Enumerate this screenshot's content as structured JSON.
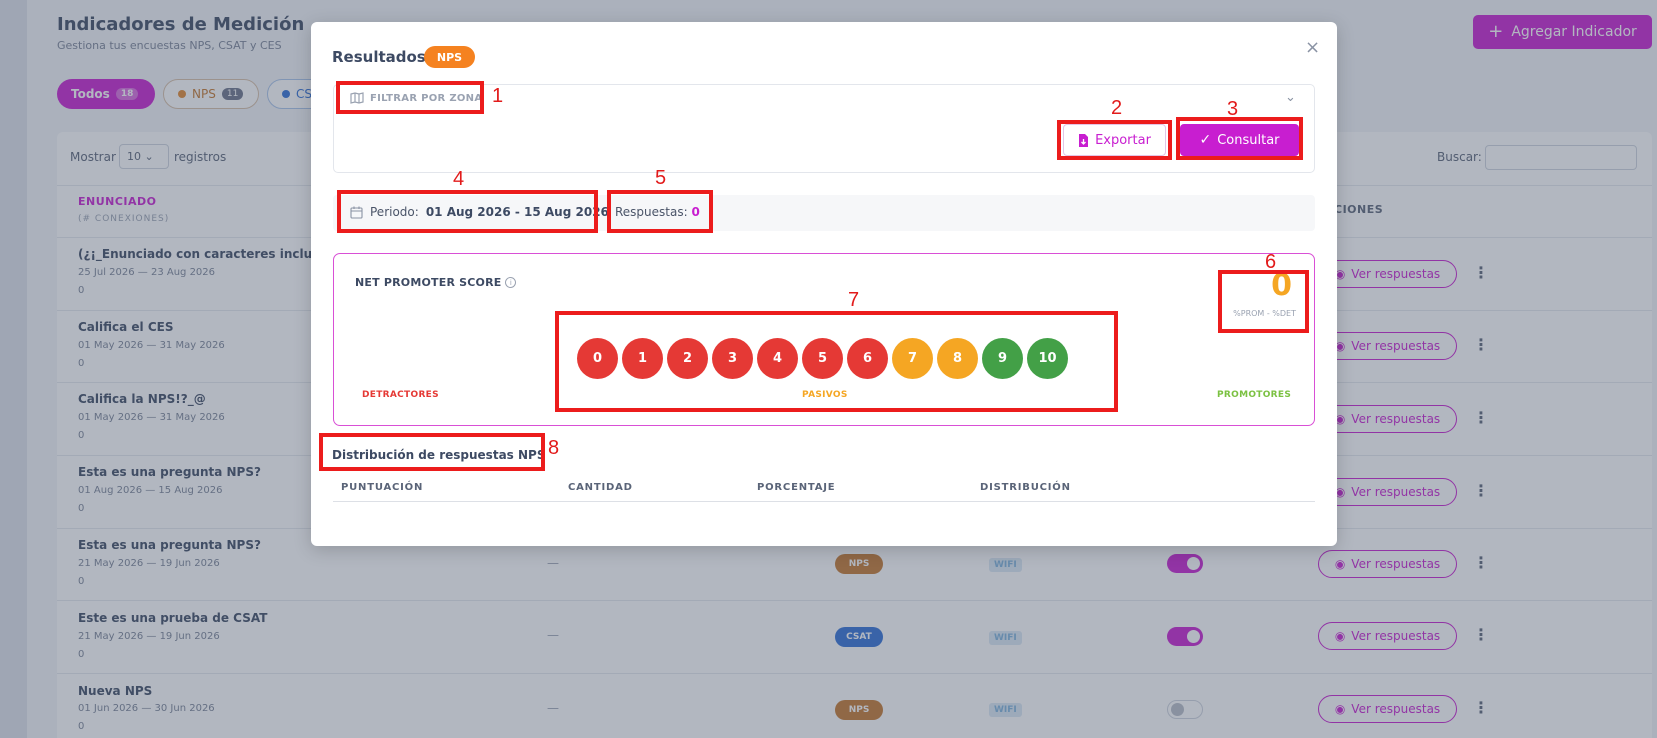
{
  "page": {
    "title": "Indicadores de Medición",
    "subtitle": "Gestiona tus encuestas NPS, CSAT y CES",
    "add_button": "Agregar Indicador",
    "filters": [
      {
        "label": "Todos",
        "count": "18"
      },
      {
        "label": "NPS",
        "count": "11"
      },
      {
        "label": "CS",
        "count": ""
      }
    ],
    "show_prefix": "Mostrar",
    "show_value": "10",
    "show_suffix": "registros",
    "search_label": "Buscar:",
    "col_enunciado": "ENUNCIADO",
    "col_enunciado_sub": "(# CONEXIONES)",
    "col_acciones": "CIONES",
    "rows": [
      {
        "title": "(¿¡_Enunciado con caracteres inclusivo",
        "dates": "25 Jul 2026 — 23 Aug 2026",
        "count": "0",
        "action": "Ver respuestas"
      },
      {
        "title": "Califica el CES",
        "dates": "01 May 2026 — 31 May 2026",
        "count": "0",
        "action": "Ver respuestas"
      },
      {
        "title": "Califica la NPS!?_@",
        "dates": "01 May 2026 — 31 May 2026",
        "count": "0",
        "action": "Ver respuestas"
      },
      {
        "title": "Esta es una pregunta NPS?",
        "dates": "01 Aug 2026 — 15 Aug 2026",
        "count": "0",
        "action": "Ver respuestas"
      },
      {
        "title": "Esta es una pregunta NPS?",
        "dates": "21 May 2026 — 19 Jun 2026",
        "count": "0",
        "dash": "—",
        "type": "NPS",
        "channel": "WIFI",
        "active": true,
        "action": "Ver respuestas"
      },
      {
        "title": "Este es una prueba de CSAT",
        "dates": "21 May 2026 — 19 Jun 2026",
        "count": "0",
        "dash": "—",
        "type": "CSAT",
        "channel": "WIFI",
        "active": true,
        "action": "Ver respuestas"
      },
      {
        "title": "Nueva NPS",
        "dates": "01 Jun 2026 — 30 Jun 2026",
        "count": "0",
        "dash": "—",
        "type": "NPS",
        "channel": "WIFI",
        "active": false,
        "action": "Ver respuestas"
      }
    ]
  },
  "modal": {
    "title": "Resultados",
    "badge": "NPS",
    "close": "×",
    "filter_zone": "FILTRAR POR ZONA",
    "export": "Exportar",
    "consult": "Consultar",
    "period_label": "Periodo:",
    "period_value": "01 Aug 2026 - 15 Aug 2026",
    "responses_label": "Respuestas:",
    "responses_value": "0",
    "nps_title": "NET PROMOTER SCORE",
    "nps_value": "0",
    "nps_sub": "%PROM - %DET",
    "scale": [
      {
        "n": "0",
        "color": "#e53935"
      },
      {
        "n": "1",
        "color": "#e53935"
      },
      {
        "n": "2",
        "color": "#e53935"
      },
      {
        "n": "3",
        "color": "#e53935"
      },
      {
        "n": "4",
        "color": "#e53935"
      },
      {
        "n": "5",
        "color": "#e53935"
      },
      {
        "n": "6",
        "color": "#e53935"
      },
      {
        "n": "7",
        "color": "#f5a623"
      },
      {
        "n": "8",
        "color": "#f5a623"
      },
      {
        "n": "9",
        "color": "#43a047"
      },
      {
        "n": "10",
        "color": "#43a047"
      }
    ],
    "cat_detractores": "DETRACTORES",
    "cat_pasivos": "PASIVOS",
    "cat_promotores": "PROMOTORES",
    "dist_title": "Distribución de respuestas NPS",
    "dist_cols": [
      "PUNTUACIÓN",
      "CANTIDAD",
      "PORCENTAJE",
      "DISTRIBUCIÓN"
    ]
  },
  "annotations": [
    "1",
    "2",
    "3",
    "4",
    "5",
    "6",
    "7",
    "8"
  ],
  "colors": {
    "accent": "#c81ed0",
    "nps_badge": "#f58220",
    "annotation": "#ec1c1c"
  }
}
